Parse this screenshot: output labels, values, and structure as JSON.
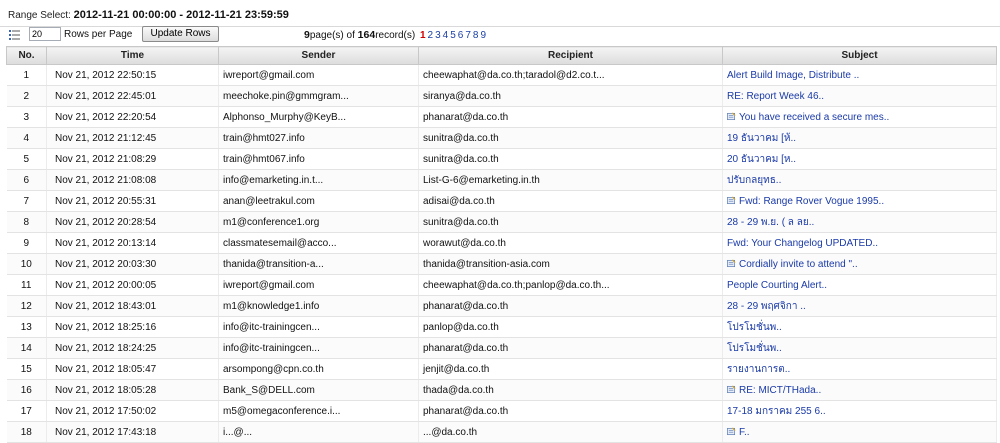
{
  "range": {
    "label": "Range Select:",
    "value": "2012-11-21 00:00:00 - 2012-11-21 23:59:59"
  },
  "toolbar": {
    "rows_value": "20",
    "rows_label": "Rows per Page",
    "update_label": "Update Rows"
  },
  "pager": {
    "page_count": "9",
    "pages_text": "page(s) of",
    "record_count": "164",
    "records_text": "record(s)",
    "pages": [
      "1",
      "2",
      "3",
      "4",
      "5",
      "6",
      "7",
      "8",
      "9"
    ],
    "current": "1"
  },
  "columns": [
    "No.",
    "Time",
    "Sender",
    "Recipient",
    "Subject"
  ],
  "rows": [
    {
      "no": "1",
      "time": "Nov 21, 2012 22:50:15",
      "sender": "iwreport@gmail.com",
      "recipient": "cheewaphat@da.co.th;taradol@d2.co.t...",
      "subject": "Alert Build Image, Distribute ..",
      "icon": false
    },
    {
      "no": "2",
      "time": "Nov 21, 2012 22:45:01",
      "sender": "meechoke.pin@gmmgram...",
      "recipient": "siranya@da.co.th",
      "subject": "RE: Report Week 46..",
      "icon": false
    },
    {
      "no": "3",
      "time": "Nov 21, 2012 22:20:54",
      "sender": "Alphonso_Murphy@KeyB...",
      "recipient": "phanarat@da.co.th",
      "subject": "You have received a secure mes..",
      "icon": true
    },
    {
      "no": "4",
      "time": "Nov 21, 2012 21:12:45",
      "sender": "train@hmt027.info",
      "recipient": "sunitra@da.co.th",
      "subject": "19 ธันวาคม [ห้..",
      "icon": false
    },
    {
      "no": "5",
      "time": "Nov 21, 2012 21:08:29",
      "sender": "train@hmt067.info",
      "recipient": "sunitra@da.co.th",
      "subject": "20 ธันวาคม [ห..",
      "icon": false
    },
    {
      "no": "6",
      "time": "Nov 21, 2012 21:08:08",
      "sender": "info@emarketing.in.t...",
      "recipient": "List-G-6@emarketing.in.th",
      "subject": "ปรับกลยุทธ..",
      "icon": false
    },
    {
      "no": "7",
      "time": "Nov 21, 2012 20:55:31",
      "sender": "anan@leetrakul.com",
      "recipient": "adisai@da.co.th",
      "subject": "Fwd: Range Rover Vogue 1995..",
      "icon": true
    },
    {
      "no": "8",
      "time": "Nov 21, 2012 20:28:54",
      "sender": "m1@conference1.org",
      "recipient": "sunitra@da.co.th",
      "subject": "28 - 29 พ.ย. ( ล ลย..",
      "icon": false
    },
    {
      "no": "9",
      "time": "Nov 21, 2012 20:13:14",
      "sender": "classmatesemail@acco...",
      "recipient": "worawut@da.co.th",
      "subject": "Fwd: Your Changelog UPDATED..",
      "icon": false
    },
    {
      "no": "10",
      "time": "Nov 21, 2012 20:03:30",
      "sender": "thanida@transition-a...",
      "recipient": "thanida@transition-asia.com",
      "subject": "Cordially invite to attend \"..",
      "icon": true
    },
    {
      "no": "11",
      "time": "Nov 21, 2012 20:00:05",
      "sender": "iwreport@gmail.com",
      "recipient": "cheewaphat@da.co.th;panlop@da.co.th...",
      "subject": "People Courting Alert..",
      "icon": false
    },
    {
      "no": "12",
      "time": "Nov 21, 2012 18:43:01",
      "sender": "m1@knowledge1.info",
      "recipient": "phanarat@da.co.th",
      "subject": "28 - 29 พฤศจิกา ..",
      "icon": false
    },
    {
      "no": "13",
      "time": "Nov 21, 2012 18:25:16",
      "sender": "info@itc-trainingcen...",
      "recipient": "panlop@da.co.th",
      "subject": "โปรโมชั่นพ..",
      "icon": false
    },
    {
      "no": "14",
      "time": "Nov 21, 2012 18:24:25",
      "sender": "info@itc-trainingcen...",
      "recipient": "phanarat@da.co.th",
      "subject": "โปรโมชั่นพ..",
      "icon": false
    },
    {
      "no": "15",
      "time": "Nov 21, 2012 18:05:47",
      "sender": "arsompong@cpn.co.th",
      "recipient": "jenjit@da.co.th",
      "subject": "รายงานการต..",
      "icon": false
    },
    {
      "no": "16",
      "time": "Nov 21, 2012 18:05:28",
      "sender": "Bank_S@DELL.com",
      "recipient": "thada@da.co.th",
      "subject": "RE: MICT/THada..",
      "icon": true
    },
    {
      "no": "17",
      "time": "Nov 21, 2012 17:50:02",
      "sender": "m5@omegaconference.i...",
      "recipient": "phanarat@da.co.th",
      "subject": "17-18 มกราคม 255 6..",
      "icon": false
    },
    {
      "no": "18",
      "time": "Nov 21, 2012 17:43:18",
      "sender": "i...@...",
      "recipient": "...@da.co.th",
      "subject": "F..",
      "icon": true
    }
  ]
}
